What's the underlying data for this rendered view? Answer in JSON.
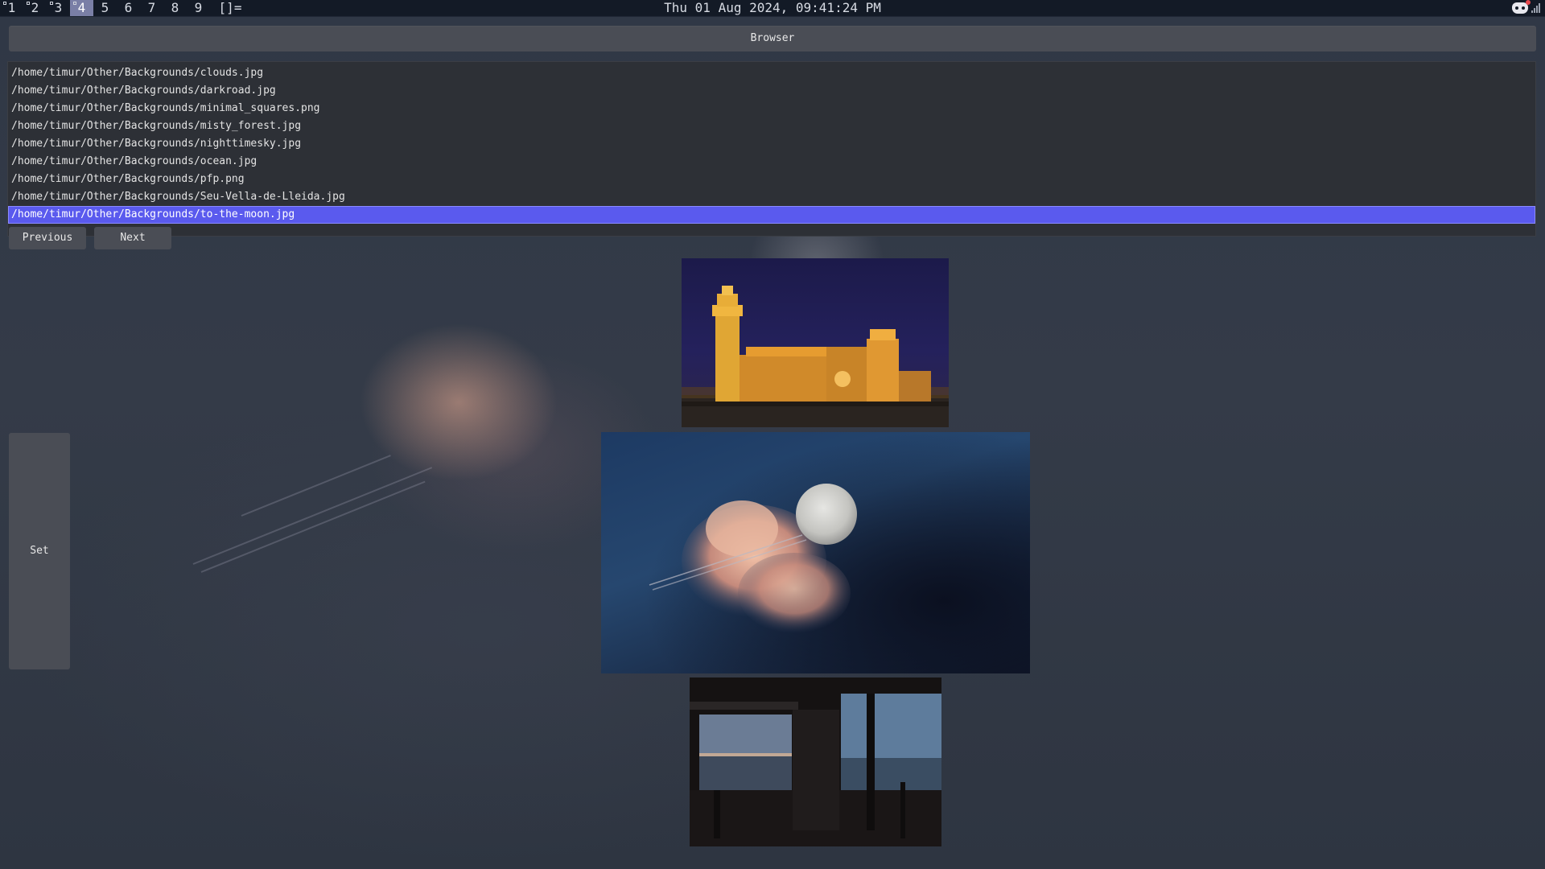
{
  "topbar": {
    "tags": [
      {
        "label": "1",
        "occupied": true,
        "active": false
      },
      {
        "label": "2",
        "occupied": true,
        "active": false
      },
      {
        "label": "3",
        "occupied": true,
        "active": false
      },
      {
        "label": "4",
        "occupied": true,
        "active": true
      },
      {
        "label": "5",
        "occupied": false,
        "active": false
      },
      {
        "label": "6",
        "occupied": false,
        "active": false
      },
      {
        "label": "7",
        "occupied": false,
        "active": false
      },
      {
        "label": "8",
        "occupied": false,
        "active": false
      },
      {
        "label": "9",
        "occupied": false,
        "active": false
      }
    ],
    "layout_symbol": "[]=",
    "clock": "Thu 01 Aug 2024, 09:41:24 PM",
    "tray_icons": [
      "discord-icon",
      "signal-icon"
    ]
  },
  "app": {
    "browser_label": "Browser",
    "files": [
      "/home/timur/Other/Backgrounds/clouds.jpg",
      "/home/timur/Other/Backgrounds/darkroad.jpg",
      "/home/timur/Other/Backgrounds/minimal_squares.png",
      "/home/timur/Other/Backgrounds/misty_forest.jpg",
      "/home/timur/Other/Backgrounds/nighttimesky.jpg",
      "/home/timur/Other/Backgrounds/ocean.jpg",
      "/home/timur/Other/Backgrounds/pfp.png",
      "/home/timur/Other/Backgrounds/Seu-Vella-de-Lleida.jpg",
      "/home/timur/Other/Backgrounds/to-the-moon.jpg"
    ],
    "selected_index": 8,
    "previous_label": "Previous",
    "next_label": "Next",
    "set_label": "Set"
  },
  "colors": {
    "selection": "#5a5aee",
    "button": "#4a4d55",
    "bar": "#131a26",
    "active_tag": "#7a7fa6"
  }
}
